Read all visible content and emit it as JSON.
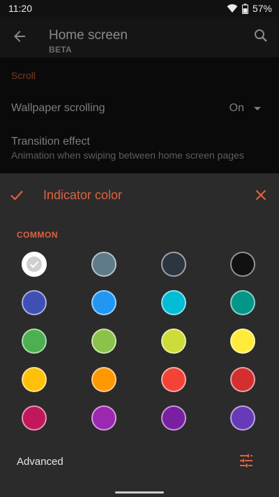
{
  "status": {
    "time": "11:20",
    "battery": "57%"
  },
  "appbar": {
    "title": "Home screen",
    "subtitle": "BETA"
  },
  "background": {
    "section": "Scroll",
    "wallpaper_label": "Wallpaper scrolling",
    "wallpaper_value": "On",
    "transition_label": "Transition effect",
    "transition_sub": "Animation when swiping between home screen pages"
  },
  "sheet": {
    "title": "Indicator color",
    "section": "COMMON",
    "advanced": "Advanced",
    "accent": "#e2603f",
    "colors": [
      "#ffffff",
      "#5f7a8a",
      "#2b3640",
      "#111111",
      "#3f50b5",
      "#2196f3",
      "#00bcd4",
      "#009688",
      "#4caf50",
      "#8bc34a",
      "#cddc39",
      "#ffeb3b",
      "#ffc107",
      "#ff9800",
      "#f44336",
      "#d32f2f",
      "#c2185b",
      "#9c27b0",
      "#7b1fa2",
      "#673ab7"
    ]
  }
}
